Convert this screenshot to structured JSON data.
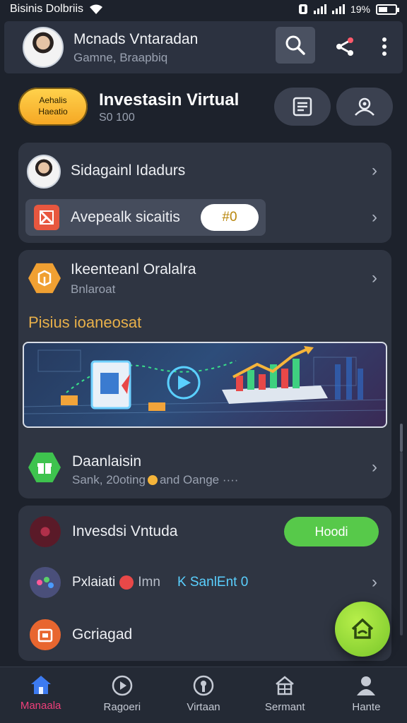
{
  "status_bar": {
    "carrier": "Bisinis Dolbriis",
    "battery_text": "19%"
  },
  "header": {
    "name": "Mcnads Vntaradan",
    "subtitle": "Gamne, Braapbiq",
    "icons": [
      "search-icon",
      "share-icon",
      "more-vertical-icon"
    ]
  },
  "balance": {
    "badge_line1": "Aehalis",
    "badge_line2": "Haeatio",
    "title": "Investasin Virtual",
    "subtitle": "S0 100"
  },
  "card1": {
    "profile_label": "Sidagainl Idadurs",
    "promo_label": "Avepealk sicaitis",
    "promo_pill": "#0"
  },
  "card2": {
    "title": "Ikeenteanl Oralalra",
    "subtitle": "Bnlaroat",
    "section_heading": "Pisius ioaneosat",
    "bottom_title": "Daanlaisin",
    "bottom_subtitle_a": "Sank, 20oting",
    "bottom_subtitle_b": "and Oange ····"
  },
  "card3": {
    "row1_label": "Invesdsi Vntuda",
    "row1_button": "Hoodi",
    "row2_label_a": "Pxlaiati",
    "row2_label_b": "Imn",
    "row2_label_c": "K SanlEnt 0",
    "row3_label": "Gcriagad"
  },
  "tabs": [
    {
      "label": "Manaala",
      "icon": "home-icon",
      "active": true
    },
    {
      "label": "Ragoeri",
      "icon": "play-circle-icon",
      "active": false
    },
    {
      "label": "Virtaan",
      "icon": "lock-circle-icon",
      "active": false
    },
    {
      "label": "Sermant",
      "icon": "house-grid-icon",
      "active": false
    },
    {
      "label": "Hante",
      "icon": "person-icon",
      "active": false
    }
  ],
  "colors": {
    "background": "#1d222c",
    "card": "#2f3542",
    "accent_active": "#ef3f7a",
    "accent_gold": "#f5a623",
    "accent_green": "#5fcf3a",
    "heading_gold": "#e8b04a"
  }
}
